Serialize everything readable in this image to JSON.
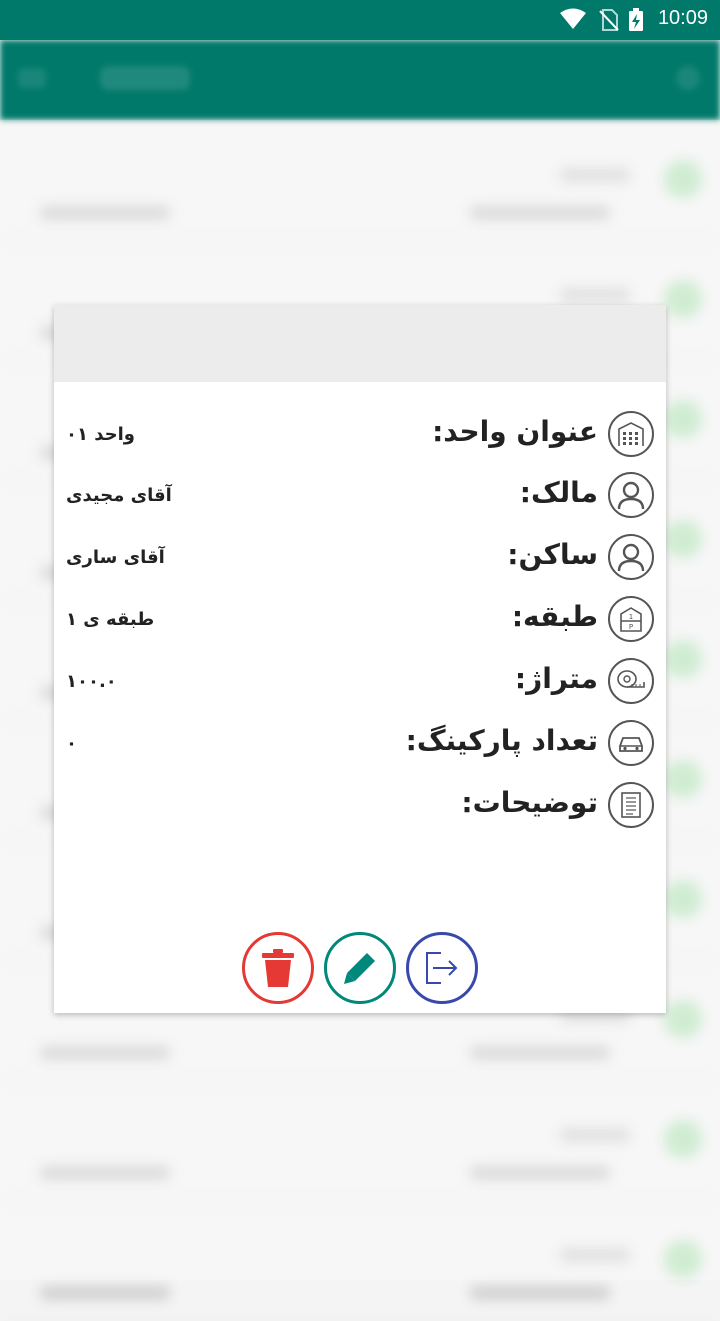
{
  "status_bar": {
    "time": "10:09",
    "icons": [
      "wifi-icon",
      "no-sim-icon",
      "battery-charging-icon"
    ]
  },
  "dialog": {
    "rows": [
      {
        "icon": "building-icon",
        "label": "عنوان واحد:",
        "value": "واحد ۰۱"
      },
      {
        "icon": "person-icon",
        "label": "مالک:",
        "value": "آقای مجیدی"
      },
      {
        "icon": "person-icon",
        "label": "ساکن:",
        "value": "آقای ساری"
      },
      {
        "icon": "floor-icon",
        "label": "طبقه:",
        "value": "طبقه ی ۱"
      },
      {
        "icon": "tape-measure-icon",
        "label": "متراژ:",
        "value": "۱۰۰.۰"
      },
      {
        "icon": "car-icon",
        "label": "تعداد پارکینگ:",
        "value": "۰"
      },
      {
        "icon": "notes-icon",
        "label": "توضیحات:",
        "value": ""
      }
    ],
    "actions": [
      {
        "name": "delete",
        "icon": "trash-icon",
        "color": "#e53935"
      },
      {
        "name": "edit",
        "icon": "pencil-icon",
        "color": "#00897b"
      },
      {
        "name": "exit",
        "icon": "exit-icon",
        "color": "#3949ab"
      }
    ]
  },
  "colors": {
    "primary": "#00796b",
    "delete": "#e53935",
    "edit": "#00897b",
    "exit": "#3949ab"
  }
}
